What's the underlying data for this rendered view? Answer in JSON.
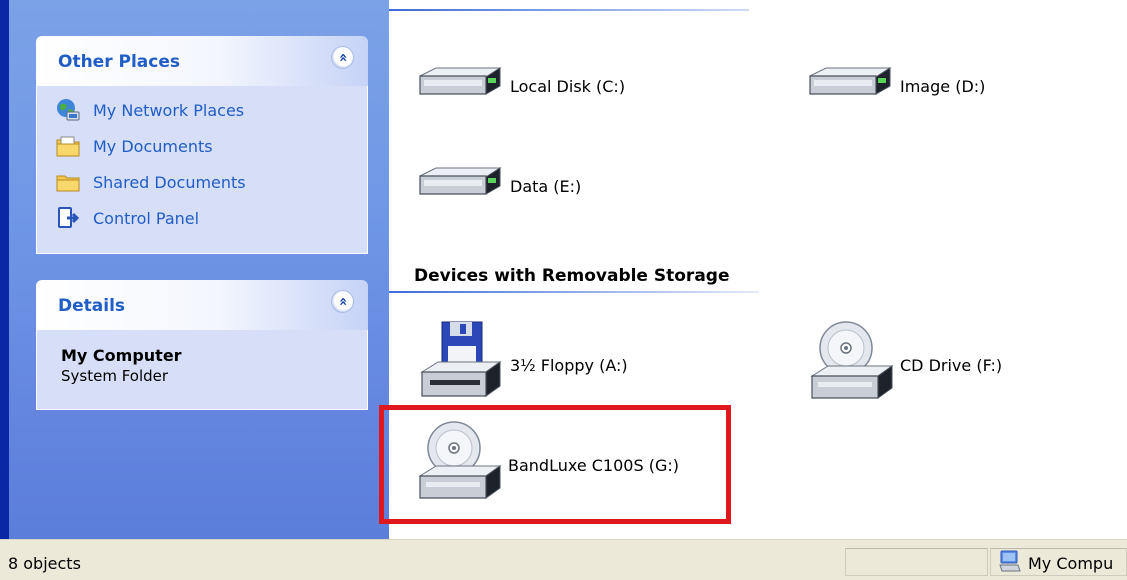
{
  "sidebar": {
    "other_places": {
      "title": "Other Places",
      "collapse_glyph": "«",
      "items": [
        {
          "label": "My Network Places",
          "icon": "network-places-icon"
        },
        {
          "label": "My Documents",
          "icon": "documents-folder-icon"
        },
        {
          "label": "Shared Documents",
          "icon": "shared-folder-icon"
        },
        {
          "label": "Control Panel",
          "icon": "control-panel-icon"
        }
      ]
    },
    "details": {
      "title": "Details",
      "collapse_glyph": "«",
      "name": "My Computer",
      "type": "System Folder"
    }
  },
  "main": {
    "hard_drives": [
      {
        "label": "Local Disk (C:)",
        "icon": "hard-disk-icon"
      },
      {
        "label": "Image (D:)",
        "icon": "hard-disk-icon"
      },
      {
        "label": "Data (E:)",
        "icon": "hard-disk-icon"
      }
    ],
    "removable_group_title": "Devices with Removable Storage",
    "removable": [
      {
        "label": "3½ Floppy (A:)",
        "icon": "floppy-drive-icon"
      },
      {
        "label": "CD Drive (F:)",
        "icon": "cd-drive-icon"
      },
      {
        "label": "BandLuxe C100S (G:)",
        "icon": "cd-drive-icon",
        "highlighted": true
      }
    ]
  },
  "statusbar": {
    "object_count": "8 objects",
    "location": "My Compu",
    "location_icon": "my-computer-icon"
  },
  "colors": {
    "taskpane_blue": "#6f97e6",
    "link_blue": "#215dc6",
    "highlight_red": "#e0171d",
    "statusbar_bg": "#ece9d8"
  }
}
